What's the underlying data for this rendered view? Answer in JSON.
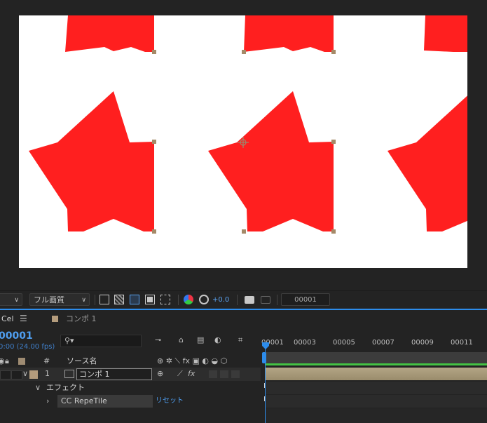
{
  "viewer": {
    "resolution_select": "フル画質",
    "exposure_value": "+0.0",
    "current_frame_field": "00001"
  },
  "tabs": {
    "left_tab_label": "Cel",
    "comp_tab_label": "コンポ 1",
    "comp_tab_color": "#b49c7d"
  },
  "timeline": {
    "timecode": "00001",
    "timecode_sub": "0:00 (24.00 fps)",
    "search_placeholder": "",
    "columns": {
      "label_marker": "#",
      "source_name": "ソース名"
    },
    "ruler_ticks": [
      "00001",
      "00003",
      "00005",
      "00007",
      "00009",
      "00011"
    ],
    "layers": [
      {
        "index": "1",
        "name": "コンポ 1",
        "label_color": "#b49c7d"
      }
    ],
    "effects_group_label": "エフェクト",
    "effect": {
      "name": "CC RepeTile",
      "reset_label": "リセット"
    },
    "accent_color": "#2d8ceb",
    "work_area_color": "#43c244"
  },
  "colors": {
    "star": "#ff1f1f",
    "canvas_bg": "#ffffff",
    "panel_bg": "#232323"
  }
}
